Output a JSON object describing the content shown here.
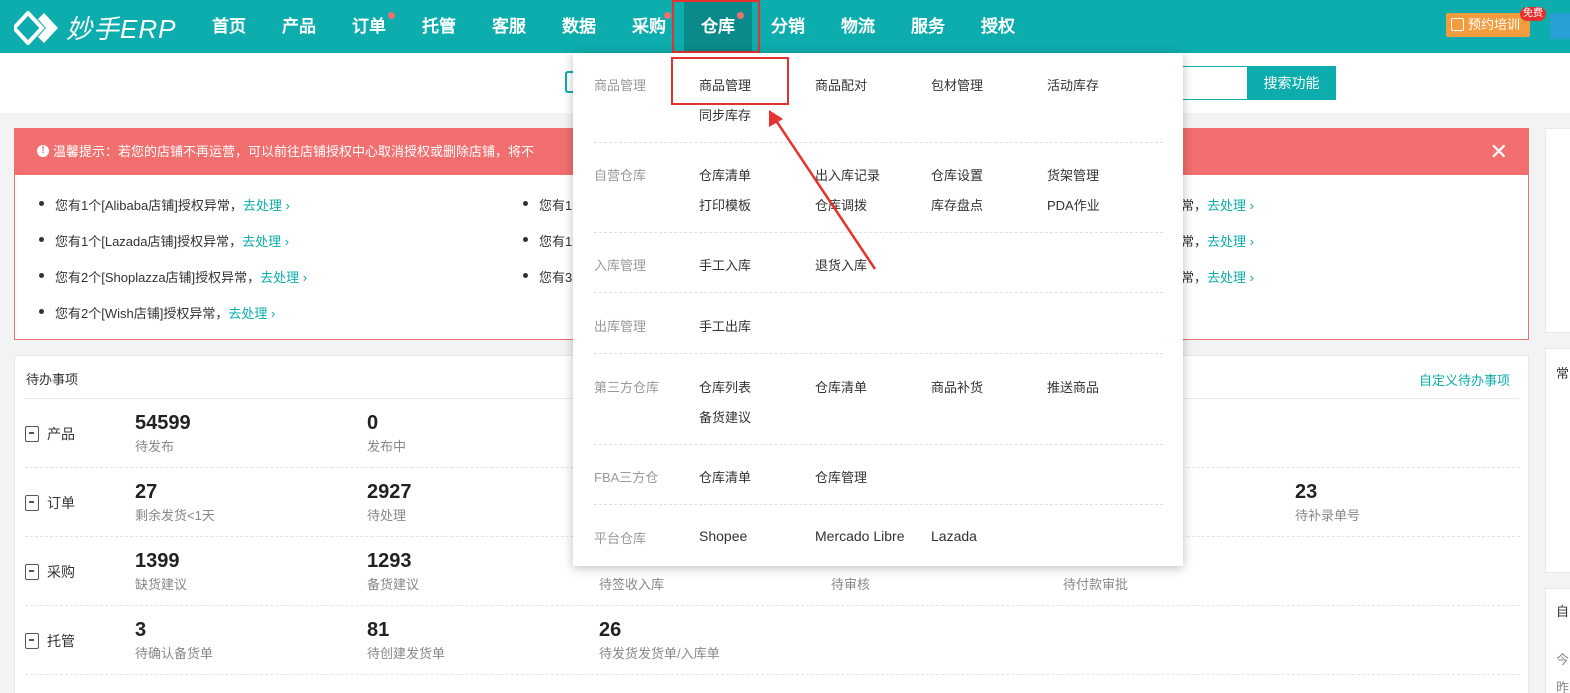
{
  "app": {
    "logo_text": "妙手ERP"
  },
  "nav": {
    "items": [
      {
        "label": "首页",
        "dot": false
      },
      {
        "label": "产品",
        "dot": false
      },
      {
        "label": "订单",
        "dot": true
      },
      {
        "label": "托管",
        "dot": false
      },
      {
        "label": "客服",
        "dot": false
      },
      {
        "label": "数据",
        "dot": false
      },
      {
        "label": "采购",
        "dot": true
      },
      {
        "label": "仓库",
        "dot": true,
        "active": true
      },
      {
        "label": "分销",
        "dot": false
      },
      {
        "label": "物流",
        "dot": false
      },
      {
        "label": "服务",
        "dot": false
      },
      {
        "label": "授权",
        "dot": false
      }
    ],
    "train_label": "预约培训",
    "free_badge": "免费"
  },
  "search": {
    "button_label": "搜索功能"
  },
  "alert": {
    "text": "温馨提示：若您的店铺不再运营，可以前往店铺授权中心取消授权或删除店铺，将不",
    "close_glyph": "✕",
    "items": [
      {
        "text": "您有1个[Alibaba店铺]授权异常，",
        "link": "去处理 ›"
      },
      {
        "text": "您有1个[Lazada店铺]授权异常，",
        "link": "去处理 ›"
      },
      {
        "text": "您有2个[Shoplazza店铺]授权异常，",
        "link": "去处理 ›"
      },
      {
        "text": "您有2个[Wish店铺]授权异常，",
        "link": "去处理 ›"
      }
    ],
    "mid_items": [
      "您有1",
      "您有1",
      "您有3"
    ],
    "right_items": [
      {
        "text": "常，",
        "link": "去处理 ›"
      },
      {
        "text": "常，",
        "link": "去处理 ›"
      },
      {
        "text": "常，",
        "link": "去处理 ›"
      }
    ]
  },
  "todo": {
    "title": "待办事项",
    "custom_label": "自定义待办事项",
    "rows": [
      {
        "label": "产品",
        "cells": [
          {
            "num": "54599",
            "label": "待发布"
          },
          {
            "num": "0",
            "label": "发布中"
          }
        ]
      },
      {
        "label": "订单",
        "cells": [
          {
            "num": "27",
            "label": "剩余发货<1天"
          },
          {
            "num": "2927",
            "label": "待处理"
          },
          {
            "num": "23",
            "label": "待补录单号"
          }
        ]
      },
      {
        "label": "采购",
        "cells": [
          {
            "num": "1399",
            "label": "缺货建议"
          },
          {
            "num": "1293",
            "label": "备货建议"
          },
          {
            "num": "",
            "label": "待签收入库"
          },
          {
            "num": "",
            "label": "待审核"
          },
          {
            "num": "",
            "label": "待付款审批"
          }
        ]
      },
      {
        "label": "托管",
        "cells": [
          {
            "num": "3",
            "label": "待确认备货单"
          },
          {
            "num": "81",
            "label": "待创建发货单"
          },
          {
            "num": "26",
            "label": "待发货发货单/入库单"
          }
        ]
      }
    ]
  },
  "right_panels": {
    "p2_label": "常",
    "p3_label": "自",
    "p3_line1": "今",
    "p3_line2": "昨"
  },
  "dropdown": {
    "sections": [
      {
        "category": "商品管理",
        "links": [
          "商品管理",
          "商品配对",
          "包材管理",
          "活动库存",
          "同步库存"
        ]
      },
      {
        "category": "自营仓库",
        "links": [
          "仓库清单",
          "出入库记录",
          "仓库设置",
          "货架管理",
          "打印模板",
          "仓库调拨",
          "库存盘点",
          "PDA作业"
        ]
      },
      {
        "category": "入库管理",
        "links": [
          "手工入库",
          "退货入库"
        ]
      },
      {
        "category": "出库管理",
        "links": [
          "手工出库"
        ]
      },
      {
        "category": "第三方仓库",
        "links": [
          "仓库列表",
          "仓库清单",
          "商品补货",
          "推送商品",
          "备货建议"
        ]
      },
      {
        "category": "FBA三方仓",
        "links": [
          "仓库清单",
          "仓库管理"
        ]
      },
      {
        "category": "平台仓库",
        "links": [
          "Shopee",
          "Mercado Libre",
          "Lazada"
        ]
      }
    ]
  },
  "colors": {
    "brand": "#0dadad",
    "alert": "#f26f6f",
    "annotation": "#e5322e",
    "train": "#f39c3d"
  }
}
